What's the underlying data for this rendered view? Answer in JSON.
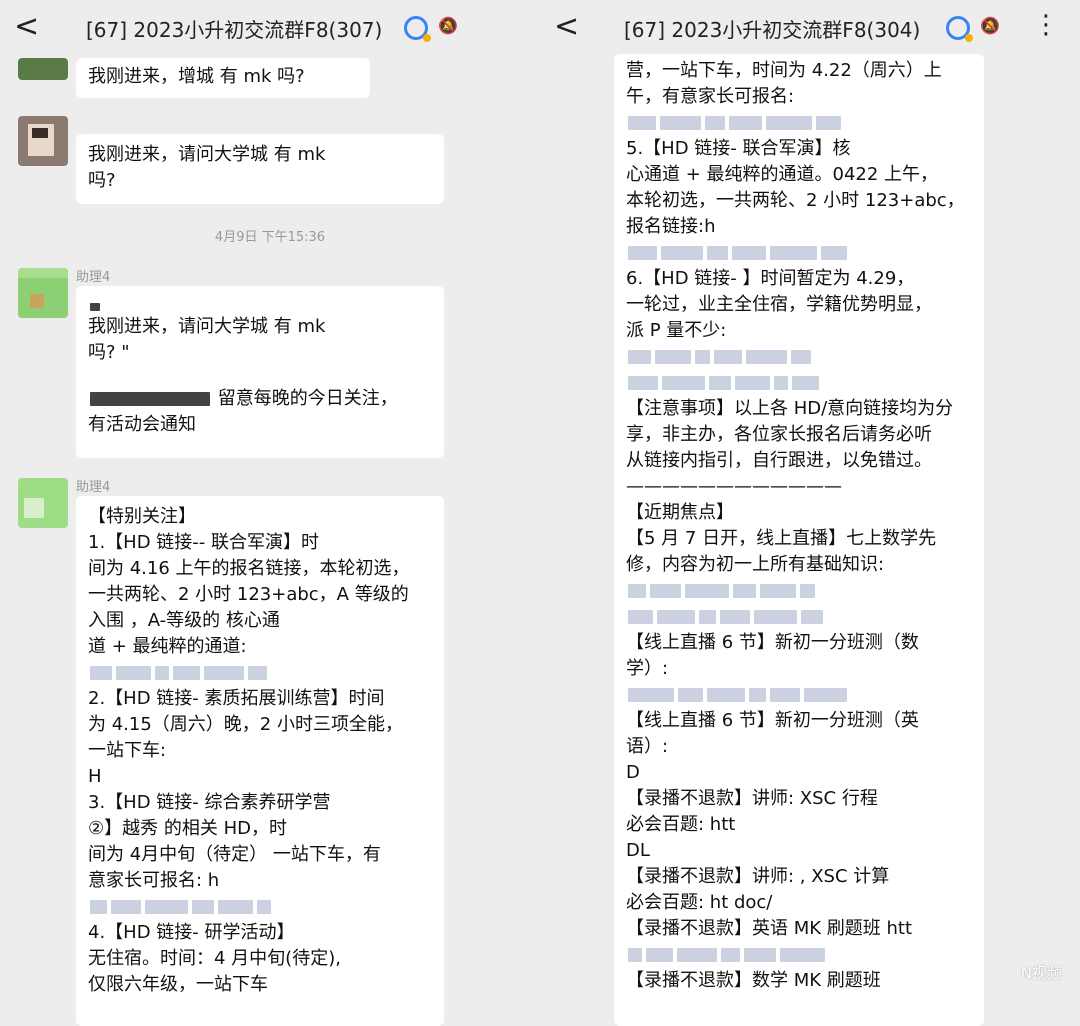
{
  "left": {
    "header": {
      "back": "<",
      "title": "[67]    2023小升初交流群F8(307)",
      "mute": "🔕"
    },
    "messages": {
      "m1": "我刚进来，增城      有 mk 吗?",
      "m2_l1": "我刚进来，请问大学城          有 mk",
      "m2_l2": "吗?",
      "time": "4月9日 下午15:36",
      "nick1": "助理4",
      "m3_q": "",
      "m3_l1": "我刚进来，请问大学城        有 mk",
      "m3_l2": "吗? \"",
      "m3_l3": "留意每晚的今日关注，",
      "m3_l4": "有活动会通知",
      "nick2": "助理4",
      "m4": [
        "【特别关注】",
        "1.【HD 链接--            联合军演】时",
        "间为 4.16 上午的报名链接，本轮初选，",
        "一共两轮、2 小时 123+abc，A 等级的",
        "入围          ，A-等级的       核心通",
        "道 + 最纯粹的通道:",
        "",
        "2.【HD 链接-      素质拓展训练营】时间",
        "为 4.15（周六）晚，2 小时三项全能，",
        "一站下车:",
        "H",
        "3.【HD 链接-           综合素养研学营",
        "②】越秀          的相关 HD，时",
        "间为 4月中旬（待定）   一站下车，有",
        "意家长可报名: h",
        "",
        "4.【HD 链接-       研学活动】",
        "          无住宿。时间：4 月中旬(待定),",
        "仅限六年级，一站下车"
      ]
    }
  },
  "right": {
    "header": {
      "back": "<",
      "title": "[67]    2023小升初交流群F8(304)",
      "mute": "🔕",
      "more": "⋮"
    },
    "bubble": [
      "营，一站下车，时间为 4.22（周六）上",
      "午，有意家长可报名:",
      "",
      "5.【HD 链接-              联合军演】核",
      "心通道 + 最纯粹的通道。0422 上午，",
      "本轮初选，一共两轮、2 小时 123+abc，",
      "报名链接:h",
      "",
      "6.【HD 链接-         】时间暂定为 4.29，",
      "一轮过，业主全住宿，学籍优势明显，",
      "派 P 量不少:",
      "",
      "",
      "【注意事项】以上各 HD/意向链接均为分",
      "享，非主办，各位家长报名后请务必听",
      "从链接内指引，自行跟进，以免错过。",
      "————————————",
      "【近期焦点】",
      "【5 月 7 日开，线上直播】七上数学先",
      "修，内容为初一上所有基础知识:",
      "",
      "",
      "【线上直播 6 节】新初一分班测（数",
      "学）:",
      "",
      "【线上直播 6 节】新初一分班测（英",
      "语）:",
      "D",
      "【录播不退款】讲师:         XSC 行程",
      "必会百题: htt",
      "DL",
      "【录播不退款】讲师:          , XSC 计算",
      "必会百题: ht                              doc/",
      "【录播不退款】英语 MK 刷题班 htt",
      "",
      "【录播不退款】数学 MK 刷题班"
    ],
    "watermark": "N视频"
  }
}
